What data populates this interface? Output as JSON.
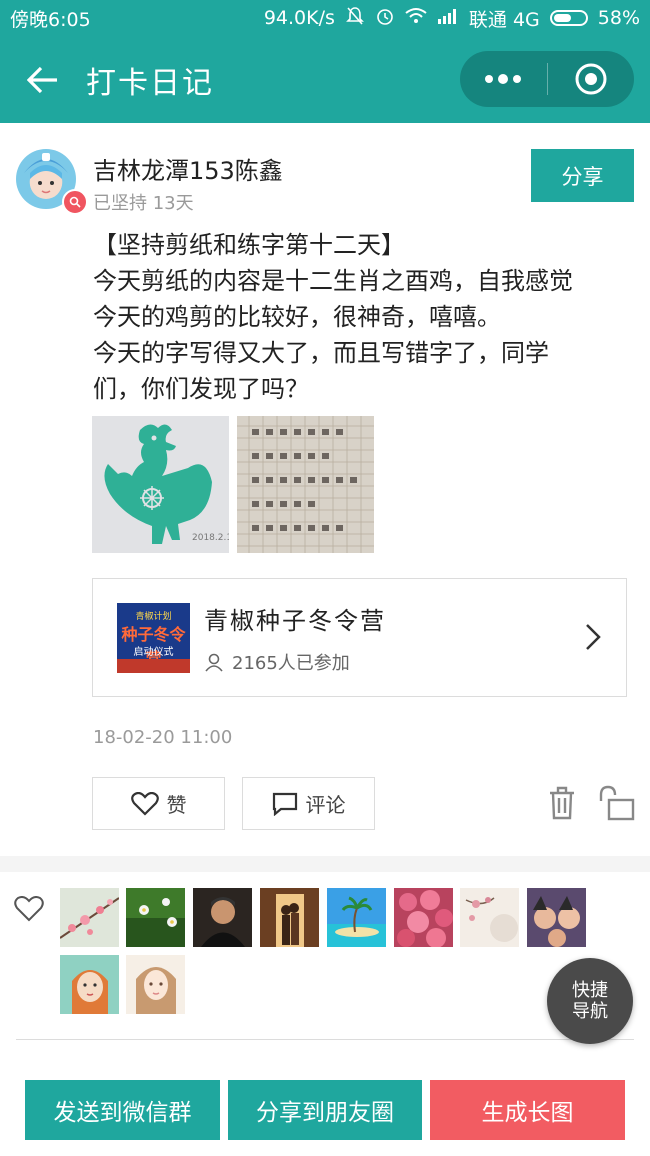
{
  "status_bar": {
    "time": "傍晚6:05",
    "speed": "94.0K/s",
    "carrier": "联通 4G",
    "battery": "58%",
    "battery_level": 0.58
  },
  "nav": {
    "title": "打卡日记",
    "icons": [
      "back-arrow-icon",
      "more-dots-icon",
      "close-target-icon"
    ]
  },
  "post": {
    "username": "吉林龙潭153陈鑫",
    "persist": "已坚持 13天",
    "share_label": "分享",
    "content_lines": [
      "【坚持剪纸和练字第十二天】",
      "今天剪纸的内容是十二生肖之酉鸡，自我感觉",
      "今天的鸡剪的比较好，很神奇，嘻嘻。",
      "今天的字写得又大了，而且写错字了，同学",
      "们，你们发现了吗？"
    ],
    "photos": [
      "rooster-papercut",
      "handwriting-page"
    ],
    "photo1_sign": "2018.2.1",
    "camp": {
      "title": "青椒种子冬令营",
      "count": "2165人已参加",
      "thumb_line1": "青椒计划",
      "thumb_line2": "种子冬令营",
      "thumb_line3": "启动仪式"
    },
    "timestamp": "18-02-20 11:00",
    "like_label": "赞",
    "comment_label": "评论",
    "icons": [
      "heart-icon",
      "comment-icon",
      "trash-icon",
      "unlock-icon"
    ]
  },
  "likers": [
    {
      "name": "plum-blossom"
    },
    {
      "name": "green-flowers"
    },
    {
      "name": "man-portrait"
    },
    {
      "name": "couple-door"
    },
    {
      "name": "tropical-island"
    },
    {
      "name": "pink-roses"
    },
    {
      "name": "chinese-painting"
    },
    {
      "name": "selfie-group"
    },
    {
      "name": "cartoon-girl"
    },
    {
      "name": "sketch-girl"
    }
  ],
  "quick_nav": {
    "line1": "快捷",
    "line2": "导航"
  },
  "bottom": {
    "send_group": "发送到微信群",
    "share_moments": "分享到朋友圈",
    "generate_image": "生成长图"
  },
  "colors": {
    "accent": "#1fa79e",
    "danger": "#f25c62"
  }
}
